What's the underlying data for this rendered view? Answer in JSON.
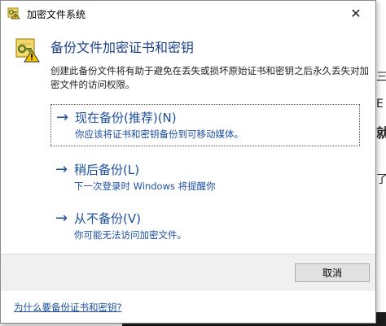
{
  "window": {
    "title": "加密文件系统",
    "close_glyph": "✕"
  },
  "header": {
    "title": "备份文件加密证书和密钥",
    "icon": "certificate-warning-icon"
  },
  "description": "创建此备份文件将有助于避免在丢失或损坏原始证书和密钥之后永久丢失对加密文件的访问权限。",
  "options": [
    {
      "arrow": "→",
      "title": "现在备份(推荐)(N)",
      "subtitle": "你应该将证书和密钥备份到可移动媒体。"
    },
    {
      "arrow": "→",
      "title": "稍后备份(L)",
      "subtitle": "下一次登录时 Windows 将提醒你"
    },
    {
      "arrow": "→",
      "title": "从不备份(V)",
      "subtitle": "你可能无法访问加密文件。"
    }
  ],
  "buttons": {
    "cancel": "取消"
  },
  "help_link": "为什么要备份证书和密钥?",
  "background": {
    "glyphs": [
      "三",
      "E",
      "就",
      "了"
    ]
  },
  "colors": {
    "link_blue": "#1c4fa0",
    "header_blue": "#1a3f8a",
    "footer_gray": "#f0f0f0"
  }
}
